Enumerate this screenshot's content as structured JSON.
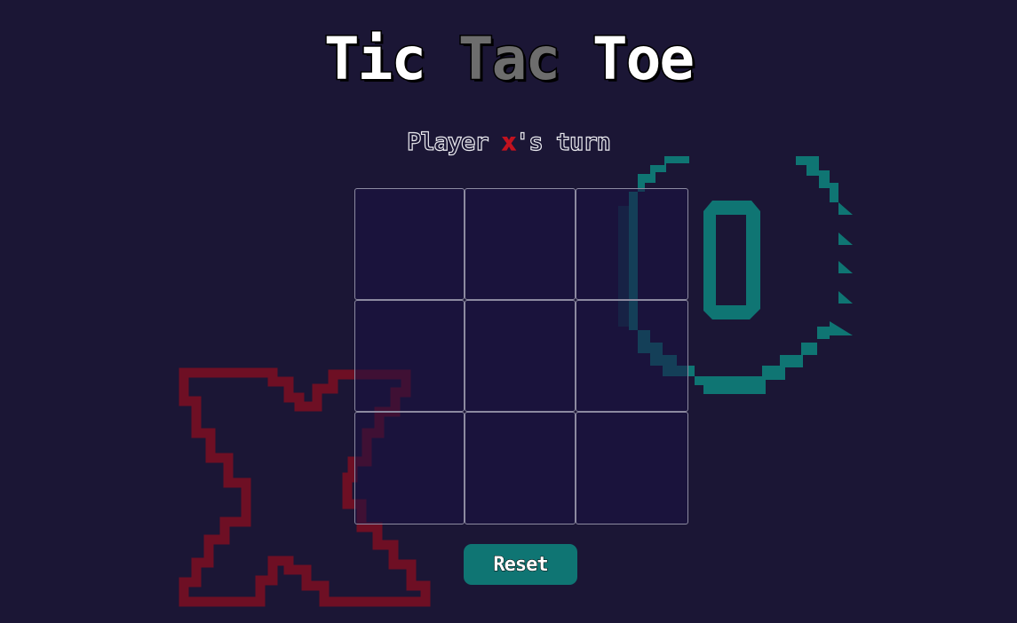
{
  "title": {
    "word1": "Tic",
    "word2": "Tac",
    "word3": "Toe"
  },
  "status": {
    "prefix": "Player ",
    "mark": "x",
    "suffix": "'s turn"
  },
  "board": {
    "cells": [
      "",
      "",
      "",
      "",
      "",
      "",
      "",
      "",
      ""
    ]
  },
  "reset_label": "Reset",
  "colors": {
    "background": "#1b1635",
    "x_color": "#c2121f",
    "o_color": "#0f7573",
    "cell_border": "#8c8aa0"
  }
}
